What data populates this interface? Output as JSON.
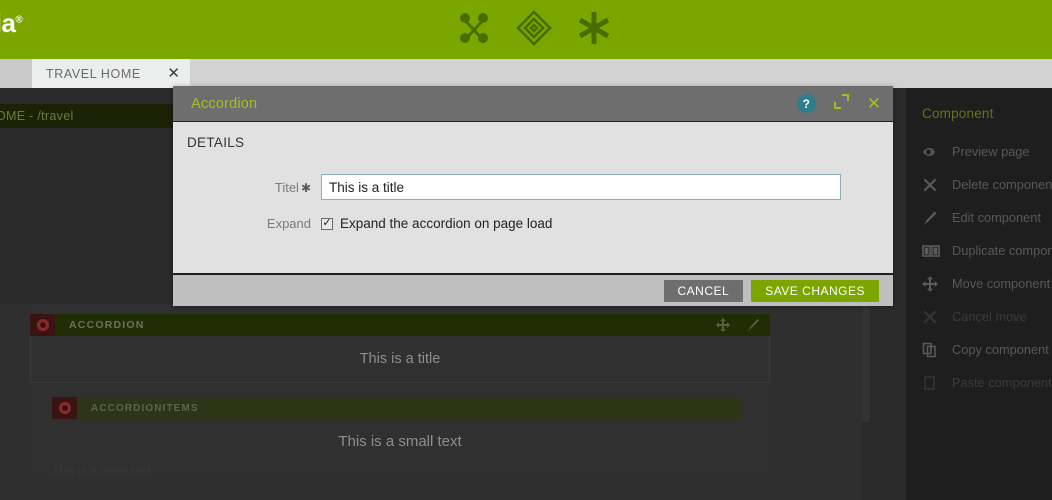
{
  "header": {
    "brand": "lia",
    "brand_mark": "®",
    "background": "#7ba600",
    "icons": [
      {
        "name": "magnolia-nodes-icon",
        "label": "nodes"
      },
      {
        "name": "magnolia-rhombus-icon",
        "label": "rhombus"
      },
      {
        "name": "magnolia-asterisk-icon",
        "label": "asterisk"
      }
    ]
  },
  "tabs": {
    "items": [
      {
        "label": "TRAVEL HOME",
        "active": true,
        "close": "✕"
      }
    ]
  },
  "workspace": {
    "page_path": "OME - /travel"
  },
  "preview": {
    "accordion": {
      "component_label": "ACCORDION",
      "title_text": "This is a title",
      "actions": [
        "move-icon",
        "edit-icon"
      ]
    },
    "accordion_items": {
      "component_label": "ACCORDIONITEMS",
      "item_text": "This is a small text",
      "item_subtext": "This is a small text"
    }
  },
  "context_menu": {
    "title": "Component",
    "items": [
      {
        "label": "Preview page",
        "icon": "preview-eye-icon",
        "disabled": false
      },
      {
        "label": "Delete component",
        "icon": "delete-x-icon",
        "disabled": false
      },
      {
        "label": "Edit component",
        "icon": "edit-pencil-icon",
        "disabled": false
      },
      {
        "label": "Duplicate component",
        "icon": "duplicate-pages-icon",
        "disabled": false
      },
      {
        "label": "Move component",
        "icon": "move-arrows-icon",
        "disabled": false
      },
      {
        "label": "Cancel move",
        "icon": "cancel-x-icon",
        "disabled": true
      },
      {
        "label": "Copy component",
        "icon": "copy-icon",
        "disabled": false
      },
      {
        "label": "Paste component",
        "icon": "paste-icon",
        "disabled": true
      }
    ]
  },
  "dialog": {
    "title": "Accordion",
    "title_color": "#a6bd27",
    "help_icon": "?",
    "expand_icon": "expand-arrows-icon",
    "close_icon": "✕",
    "section_label": "DETAILS",
    "fields": {
      "title": {
        "label": "Titel",
        "required_mark": "✱",
        "value": "This is a title",
        "placeholder": ""
      },
      "expand": {
        "label": "Expand",
        "checkbox_label": "Expand the accordion on page load",
        "checked": true,
        "check_glyph": "✓"
      }
    },
    "buttons": {
      "cancel": "CANCEL",
      "save": "SAVE CHANGES"
    },
    "colors": {
      "titlebar": "#6e6e6e",
      "body": "#e1e1e1",
      "footer": "#bfbfbf",
      "save": "#7ba600",
      "cancel": "#6e6e6e",
      "help": "#2e7d8c"
    }
  }
}
